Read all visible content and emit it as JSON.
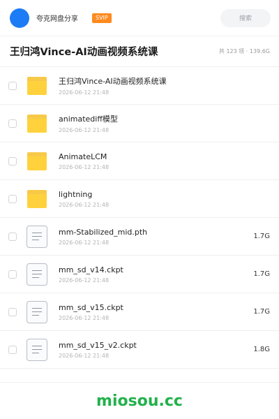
{
  "topbar": {
    "brand": "夸克网盘分享",
    "vip_badge": "SVIP",
    "search_placeholder": "搜索",
    "accent_color": "#1c7cf5"
  },
  "header": {
    "title": "王归鸿Vince-AI动画视频系统课",
    "summary": "共 123 项 · 139.6G"
  },
  "files": [
    {
      "name": "王归鸿Vince-AI动画视频系统课",
      "date": "2026-06-12 21:48",
      "type": "folder",
      "size": ""
    },
    {
      "name": "animatediff模型",
      "date": "2026-06-12 21:48",
      "type": "folder",
      "size": ""
    },
    {
      "name": "AnimateLCM",
      "date": "2026-06-12 21:48",
      "type": "folder",
      "size": ""
    },
    {
      "name": "lightning",
      "date": "2026-06-12 21:48",
      "type": "folder",
      "size": ""
    },
    {
      "name": "mm-Stabilized_mid.pth",
      "date": "2026-06-12 21:48",
      "type": "file",
      "size": "1.7G"
    },
    {
      "name": "mm_sd_v14.ckpt",
      "date": "2026-06-12 21:48",
      "type": "file",
      "size": "1.7G"
    },
    {
      "name": "mm_sd_v15.ckpt",
      "date": "2026-06-12 21:48",
      "type": "file",
      "size": "1.7G"
    },
    {
      "name": "mm_sd_v15_v2.ckpt",
      "date": "2026-06-12 21:48",
      "type": "file",
      "size": "1.8G"
    }
  ],
  "footer": {
    "watermark": "miosou.cc",
    "watermark_color": "#22b14c"
  }
}
